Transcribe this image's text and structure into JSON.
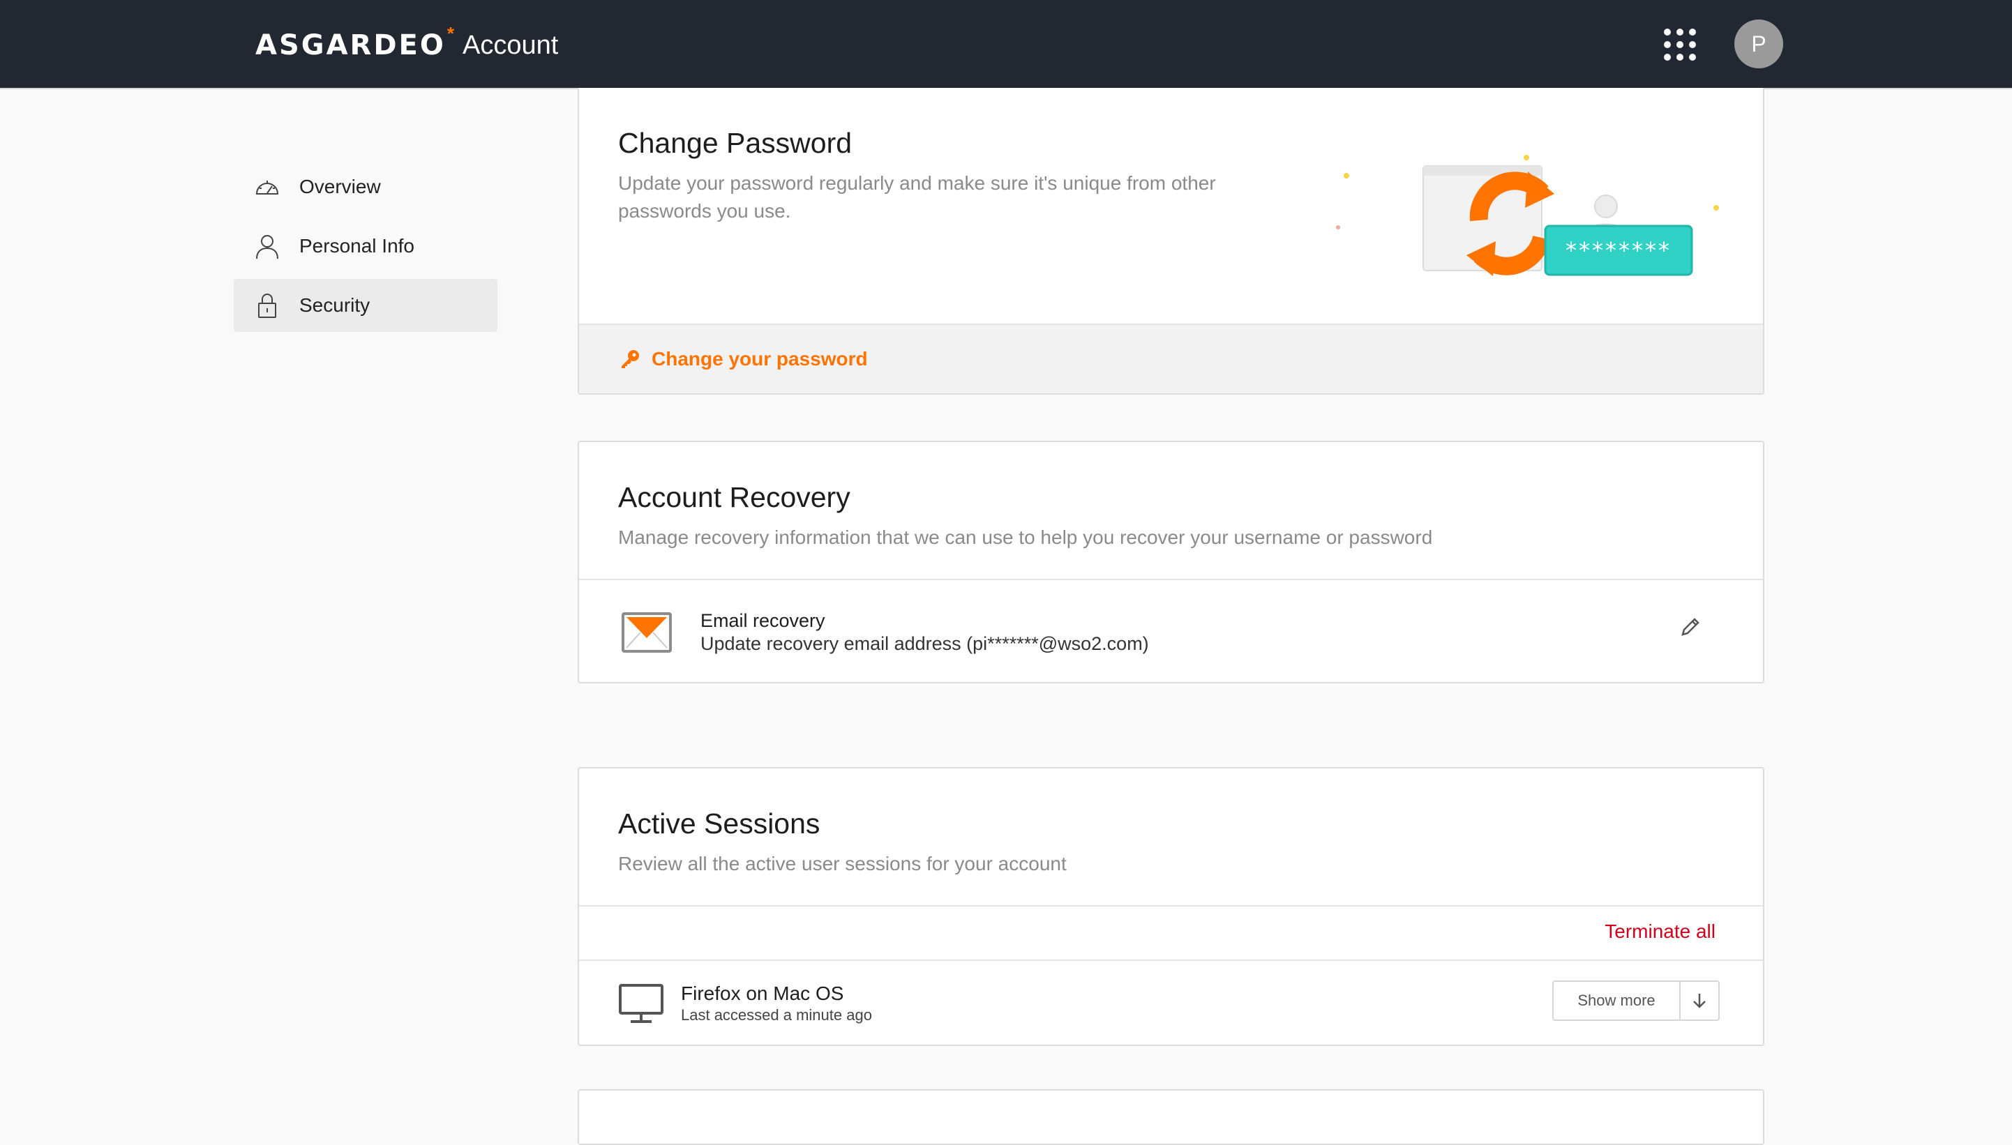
{
  "header": {
    "brand": "ASGARDEO",
    "brand_mark": "*",
    "app_name": "Account",
    "avatar_initial": "P",
    "apps_icon": "grid-icon"
  },
  "sidebar": {
    "items": [
      {
        "label": "Overview",
        "icon": "dashboard-icon",
        "active": false
      },
      {
        "label": "Personal Info",
        "icon": "user-icon",
        "active": false
      },
      {
        "label": "Security",
        "icon": "lock-icon",
        "active": true
      }
    ]
  },
  "change_password": {
    "title": "Change Password",
    "description": "Update your password regularly and make sure it's unique from other passwords you use.",
    "illustration_text": "********",
    "action_label": "Change your password",
    "action_icon": "key-icon"
  },
  "account_recovery": {
    "title": "Account Recovery",
    "description": "Manage recovery information that we can use to help you recover your username or password",
    "email_title": "Email recovery",
    "email_subtitle": "Update recovery email address (pi*******@wso2.com)",
    "edit_icon": "pencil-icon"
  },
  "active_sessions": {
    "title": "Active Sessions",
    "description": "Review all the active user sessions for your account",
    "terminate_all": "Terminate all",
    "sessions": [
      {
        "name": "Firefox on Mac OS",
        "meta": "Last accessed a minute ago",
        "icon": "monitor-icon",
        "action": "Show more"
      }
    ]
  },
  "colors": {
    "header_bg": "#212831",
    "accent": "#ff7300",
    "danger": "#d0021b",
    "teal": "#2fd2c4"
  }
}
